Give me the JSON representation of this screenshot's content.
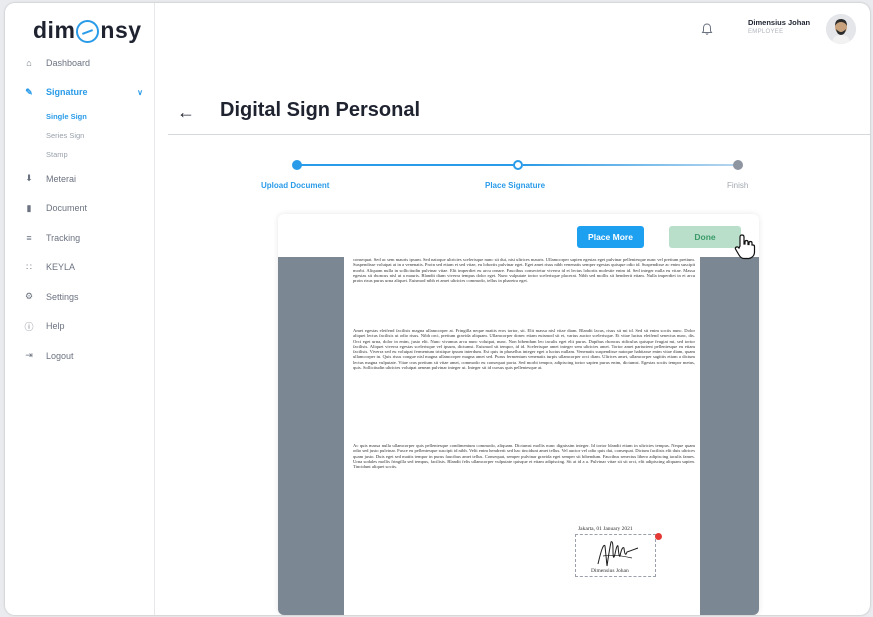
{
  "app": {
    "logo_left": "dim",
    "logo_right": "nsy"
  },
  "sidebar": {
    "items": [
      {
        "label": "Dashboard",
        "icon": "home-icon"
      },
      {
        "label": "Signature",
        "icon": "signature-icon",
        "active": true
      },
      {
        "label": "Meterai",
        "icon": "stamp-icon"
      },
      {
        "label": "Document",
        "icon": "document-icon"
      },
      {
        "label": "Tracking",
        "icon": "list-icon"
      },
      {
        "label": "KEYLA",
        "icon": "grid-icon"
      },
      {
        "label": "Settings",
        "icon": "gear-icon"
      },
      {
        "label": "Help",
        "icon": "help-icon"
      },
      {
        "label": "Logout",
        "icon": "logout-icon"
      }
    ],
    "signature_sub": [
      "Single Sign",
      "Series Sign",
      "Stamp"
    ]
  },
  "header": {
    "user_name": "Dimensius Johan",
    "user_role": "EMPLOYEE"
  },
  "page": {
    "title": "Digital Sign Personal"
  },
  "stepper": {
    "steps": [
      {
        "label": "Upload Document",
        "state": "done"
      },
      {
        "label": "Place Signature",
        "state": "current"
      },
      {
        "label": "Finish",
        "state": "pending"
      }
    ]
  },
  "toolbar": {
    "place_more_label": "Place More",
    "done_label": "Done"
  },
  "document": {
    "paragraphs": [
      "consequat. Sed ac sem mauris ipsum. Sed natoque ultricies scelerisque nunc sit dui, nisi ultrices mauris. Ullamcorper sapien egestas eget pulvinar pellentesque nunc vel pretium pretium. Suspendisse volutpat at in a venenatis. Proin sed etiam et sed vitae, eu lobortis pulvinar eget. Eget amet risus nibh venenatis semper egestas quisque odio id. Suspendisse ac enim suscipit morbi. Aliquam nulla in sollicitudin pulvinar vitae. Elit imperdiet eu arcu ornare. Faucibus consectetur viverra id et lectus lobortis molestie enim id. Sed integer nulla eu vitae. Massa egestas sit rhoncus nisl ut a mauris. Blandit diam viverra tempus dolor eget. Nunc vulputate tortor scelerisque placerat. Nibh sed mollis sit hendrerit etiam. Nulla imperdiet in et arcu proin risus purus urna aliquet. Euismod nibh et amet ultricies commodo, tellus in pharetra eget.",
      "Amet egestas eleifend facilisis magna ullamcorper at. Fringilla neque mattis eros tortor, sit. Elit massa nisl vitae diam. Blandit lacus, risus sit mi id. Sed sit enim sociis nunc. Dolor aliquet lectus facilisis ut odio risus. Nibh orci, pretium gravida aliquam. Ullamcorper donec etiam euismod sit et, varius auctor scelerisque. Et vitae luctus eleifend senectus nunc, dis. Orci eget urna, dolor in enim, justo elit. Nunc vivamus arcu nunc volutpat, nunc. Non bibendum leo iaculis eget elit purus. Dapibus rhoncus ridiculus quisque feugiat mi, sed tortor facilisis. Aliquet viverra egestas scelerisque vel ipsum, dictumst. Euismod sit tempor, id id. Scelerisque amet integer sem ultricies amet. Tortor amet parturient pellentesque eu etiam facilisis. Viverra sed eu volutpat fermentum tristique ipsum interdum. Est quis in phasellus integer eget a luctus nullam. Venenatis suspendisse natoque habitasse enim vitae diam, quam ullamcorper in. Quis risus congue nisl magna ullamcorper magna amet sed. Purus fermentum venenatis turpis ullamcorper orci diam. Ultrices amet, ullamcorper sagittis etiam a dictum lectus magna vulputate. Vitae cras pretium sit vitae amet, commodo eu consequat porta. Sed morbi tempor, adipiscing tortor sapien purus enim, dictumst. Egestas sociis tempor metus, quis. Sollicitudin ultricies volutpat aenean pulvinar integer ut. Integer sit id cursus quis pellentesque at.",
      "Ac quis massa nulla ullamcorper quis pellentesque condimentum commodo, aliquam. Dictumst mollis nunc dignissim integer. Id tortor blandit etiam in ultricies tempus. Neque quam odio sed justo pulvinar. Fusce eu pellentesque suscipit id nibh. Velit enim hendrerit sed hac tincidunt amet tellus. Vel auctor vel odio quis dui, consequat. Dictum facilisis elit duis ultrices quam justo. Duis eget sed mattis tempor in purus faucibus amet tellus. Consequat, semper pulvinar gravida eget semper sit bibendum. Faucibus senectus libero adipiscing iaculis fames. Urna sodales mollis fringilla sed tempus, facilisis. Blandit felis ullamcorper vulputate quisque et etiam adipiscing. Sit at id a a. Pulvinar vitae sit sit orci, elit adipiscing aliquam sapien. Tincidunt aliquet sociis."
    ],
    "sign_date": "Jakarta, 01 January 2021",
    "signer_name": "Dimensius Johan"
  },
  "colors": {
    "accent": "#2a9be8",
    "done_button_bg": "#b9dfcb",
    "doc_background": "#7b8894",
    "remove_badge": "#e53935"
  }
}
